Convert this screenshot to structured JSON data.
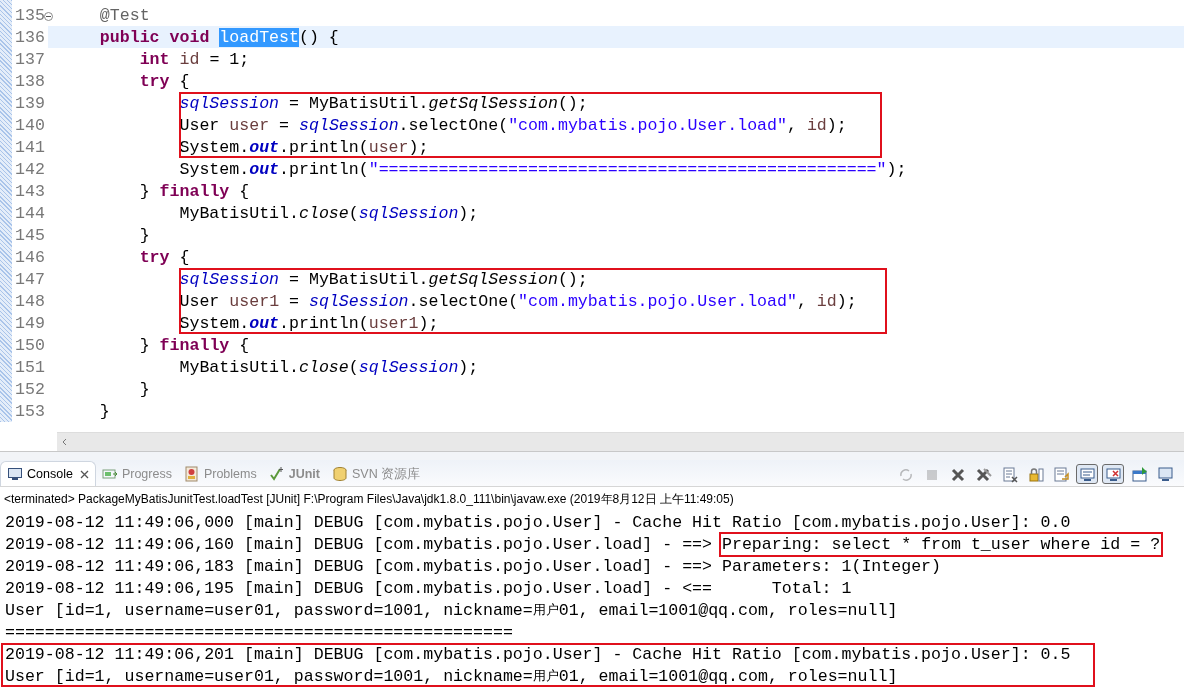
{
  "editor": {
    "lines": [
      {
        "number": "135",
        "fold": true,
        "current": false,
        "boxed": false,
        "tokens": [
          {
            "kind": "annotation",
            "text": "    @Test"
          }
        ]
      },
      {
        "number": "136",
        "fold": false,
        "current": true,
        "boxed": false,
        "tokens": [
          {
            "kind": "keyword",
            "text": "    public void "
          },
          {
            "kind": "selected",
            "text": "loadTest"
          },
          {
            "kind": "plain",
            "text": "() {"
          }
        ]
      },
      {
        "number": "137",
        "fold": false,
        "current": false,
        "boxed": false,
        "tokens": [
          {
            "kind": "keyword",
            "text": "        int "
          },
          {
            "kind": "local",
            "text": "id"
          },
          {
            "kind": "plain",
            "text": " = 1;"
          }
        ]
      },
      {
        "number": "138",
        "fold": false,
        "current": false,
        "boxed": false,
        "tokens": [
          {
            "kind": "keyword",
            "text": "        try"
          },
          {
            "kind": "plain",
            "text": " {"
          }
        ]
      },
      {
        "number": "139",
        "fold": false,
        "current": false,
        "boxed": true,
        "tokens": [
          {
            "kind": "field",
            "text": "            sqlSession"
          },
          {
            "kind": "plain",
            "text": " = MyBatisUtil."
          },
          {
            "kind": "static",
            "text": "getSqlSession"
          },
          {
            "kind": "plain",
            "text": "();"
          }
        ]
      },
      {
        "number": "140",
        "fold": false,
        "current": false,
        "boxed": true,
        "tokens": [
          {
            "kind": "plain",
            "text": "            User "
          },
          {
            "kind": "local",
            "text": "user"
          },
          {
            "kind": "plain",
            "text": " = "
          },
          {
            "kind": "field",
            "text": "sqlSession"
          },
          {
            "kind": "plain",
            "text": ".selectOne("
          },
          {
            "kind": "string",
            "text": "\"com.mybatis.pojo.User.load\""
          },
          {
            "kind": "plain",
            "text": ", "
          },
          {
            "kind": "local",
            "text": "id"
          },
          {
            "kind": "plain",
            "text": ");"
          }
        ]
      },
      {
        "number": "141",
        "fold": false,
        "current": false,
        "boxed": true,
        "tokens": [
          {
            "kind": "plain",
            "text": "            System."
          },
          {
            "kind": "constant",
            "text": "out"
          },
          {
            "kind": "plain",
            "text": ".println("
          },
          {
            "kind": "local",
            "text": "user"
          },
          {
            "kind": "plain",
            "text": ");"
          }
        ]
      },
      {
        "number": "142",
        "fold": false,
        "current": false,
        "boxed": false,
        "tokens": [
          {
            "kind": "plain",
            "text": "            System."
          },
          {
            "kind": "constant",
            "text": "out"
          },
          {
            "kind": "plain",
            "text": ".println("
          },
          {
            "kind": "string",
            "text": "\"==================================================\""
          },
          {
            "kind": "plain",
            "text": ");"
          }
        ]
      },
      {
        "number": "143",
        "fold": false,
        "current": false,
        "boxed": false,
        "tokens": [
          {
            "kind": "plain",
            "text": "        } "
          },
          {
            "kind": "keyword",
            "text": "finally"
          },
          {
            "kind": "plain",
            "text": " {"
          }
        ]
      },
      {
        "number": "144",
        "fold": false,
        "current": false,
        "boxed": false,
        "tokens": [
          {
            "kind": "plain",
            "text": "            MyBatisUtil."
          },
          {
            "kind": "static",
            "text": "close"
          },
          {
            "kind": "plain",
            "text": "("
          },
          {
            "kind": "field",
            "text": "sqlSession"
          },
          {
            "kind": "plain",
            "text": ");"
          }
        ]
      },
      {
        "number": "145",
        "fold": false,
        "current": false,
        "boxed": false,
        "tokens": [
          {
            "kind": "plain",
            "text": "        }"
          }
        ]
      },
      {
        "number": "146",
        "fold": false,
        "current": false,
        "boxed": false,
        "tokens": [
          {
            "kind": "keyword",
            "text": "        try"
          },
          {
            "kind": "plain",
            "text": " {"
          }
        ]
      },
      {
        "number": "147",
        "fold": false,
        "current": false,
        "boxed": true,
        "tokens": [
          {
            "kind": "field",
            "text": "            sqlSession"
          },
          {
            "kind": "plain",
            "text": " = MyBatisUtil."
          },
          {
            "kind": "static",
            "text": "getSqlSession"
          },
          {
            "kind": "plain",
            "text": "();"
          }
        ]
      },
      {
        "number": "148",
        "fold": false,
        "current": false,
        "boxed": true,
        "tokens": [
          {
            "kind": "plain",
            "text": "            User "
          },
          {
            "kind": "local",
            "text": "user1"
          },
          {
            "kind": "plain",
            "text": " = "
          },
          {
            "kind": "field",
            "text": "sqlSession"
          },
          {
            "kind": "plain",
            "text": ".selectOne("
          },
          {
            "kind": "string",
            "text": "\"com.mybatis.pojo.User.load\""
          },
          {
            "kind": "plain",
            "text": ", "
          },
          {
            "kind": "local",
            "text": "id"
          },
          {
            "kind": "plain",
            "text": ");"
          }
        ]
      },
      {
        "number": "149",
        "fold": false,
        "current": false,
        "boxed": true,
        "tokens": [
          {
            "kind": "plain",
            "text": "            System."
          },
          {
            "kind": "constant",
            "text": "out"
          },
          {
            "kind": "plain",
            "text": ".println("
          },
          {
            "kind": "local",
            "text": "user1"
          },
          {
            "kind": "plain",
            "text": ");"
          }
        ]
      },
      {
        "number": "150",
        "fold": false,
        "current": false,
        "boxed": false,
        "tokens": [
          {
            "kind": "plain",
            "text": "        } "
          },
          {
            "kind": "keyword",
            "text": "finally"
          },
          {
            "kind": "plain",
            "text": " {"
          }
        ]
      },
      {
        "number": "151",
        "fold": false,
        "current": false,
        "boxed": false,
        "tokens": [
          {
            "kind": "plain",
            "text": "            MyBatisUtil."
          },
          {
            "kind": "static",
            "text": "close"
          },
          {
            "kind": "plain",
            "text": "("
          },
          {
            "kind": "field",
            "text": "sqlSession"
          },
          {
            "kind": "plain",
            "text": ");"
          }
        ]
      },
      {
        "number": "152",
        "fold": false,
        "current": false,
        "boxed": false,
        "tokens": [
          {
            "kind": "plain",
            "text": "        }"
          }
        ]
      },
      {
        "number": "153",
        "fold": false,
        "current": false,
        "boxed": false,
        "tokens": [
          {
            "kind": "plain",
            "text": "    }"
          }
        ]
      }
    ]
  },
  "views": {
    "tabs": [
      {
        "label": "Console",
        "selected": true,
        "closable": true
      },
      {
        "label": "Progress",
        "selected": false,
        "closable": false
      },
      {
        "label": "Problems",
        "selected": false,
        "closable": false
      },
      {
        "label": "JUnit",
        "selected": false,
        "closable": false
      },
      {
        "label": "SVN 资源库",
        "selected": false,
        "closable": false
      }
    ],
    "toolbar": [
      {
        "disabled": true,
        "pressed": false
      },
      {
        "disabled": true,
        "pressed": false
      },
      {
        "disabled": false,
        "pressed": false
      },
      {
        "disabled": false,
        "pressed": false
      },
      {
        "disabled": false,
        "pressed": false
      },
      {
        "disabled": false,
        "pressed": false
      },
      {
        "disabled": false,
        "pressed": false
      },
      {
        "disabled": false,
        "pressed": true
      },
      {
        "disabled": false,
        "pressed": true
      },
      {
        "disabled": false,
        "pressed": false
      },
      {
        "disabled": false,
        "pressed": false
      }
    ]
  },
  "console": {
    "header": "<terminated> PackageMyBatisJunitTest.loadTest [JUnit] F:\\Program Files\\Java\\jdk1.8.0_111\\bin\\javaw.exe (2019年8月12日 上午11:49:05)",
    "lines": [
      {
        "boxed": false,
        "text": "2019-08-12 11:49:06,000 [main] DEBUG [com.mybatis.pojo.User] - Cache Hit Ratio [com.mybatis.pojo.User]: 0.0"
      },
      {
        "boxed": false,
        "text": "2019-08-12 11:49:06,160 [main] DEBUG [com.mybatis.pojo.User.load] - ==> ",
        "boxed_text": "Preparing: select * from t_user where id = ?"
      },
      {
        "boxed": false,
        "text": "2019-08-12 11:49:06,183 [main] DEBUG [com.mybatis.pojo.User.load] - ==> Parameters: 1(Integer)"
      },
      {
        "boxed": false,
        "text": "2019-08-12 11:49:06,195 [main] DEBUG [com.mybatis.pojo.User.load] - <==      Total: 1"
      },
      {
        "boxed": false,
        "text": "User [id=1, username=user01, password=1001, nickname=用户01, email=1001@qq.com, roles=null]"
      },
      {
        "boxed": false,
        "text": "==================================================="
      },
      {
        "boxed": true,
        "text": "2019-08-12 11:49:06,201 [main] DEBUG [com.mybatis.pojo.User] - Cache Hit Ratio [com.mybatis.pojo.User]: 0.5"
      },
      {
        "boxed": true,
        "text": "User [id=1, username=user01, password=1001, nickname=用户01, email=1001@qq.com, roles=null]"
      }
    ]
  }
}
